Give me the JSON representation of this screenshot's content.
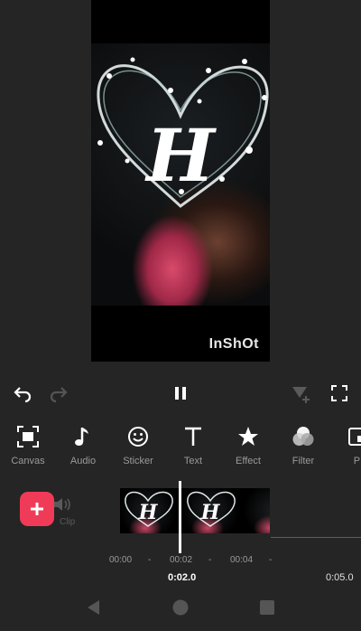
{
  "preview": {
    "watermark": "InShOt",
    "overlay_letter": "H"
  },
  "playback": {
    "undo_icon": "undo-icon",
    "redo_icon": "redo-icon",
    "pause_icon": "pause-icon",
    "keyframe_icon": "keyframe-add-icon",
    "fullscreen_icon": "fullscreen-icon"
  },
  "toolbar": {
    "items": [
      {
        "label": "Canvas",
        "icon": "canvas-icon"
      },
      {
        "label": "Audio",
        "icon": "music-note-icon"
      },
      {
        "label": "Sticker",
        "icon": "smiley-icon"
      },
      {
        "label": "Text",
        "icon": "text-icon"
      },
      {
        "label": "Effect",
        "icon": "star-icon"
      },
      {
        "label": "Filter",
        "icon": "filter-icon"
      },
      {
        "label": "PI",
        "icon": "pip-icon"
      }
    ]
  },
  "timeline": {
    "add_button_icon": "plus-icon",
    "muted_label": "Clip",
    "ticks": [
      "00:00",
      "-",
      "00:02",
      "-",
      "00:04",
      "-"
    ],
    "current_time": "0:02.0",
    "total_time": "0:05.0"
  },
  "colors": {
    "background": "#252525",
    "accent": "#ef3b57",
    "timeline_line": "#6a4e88"
  }
}
